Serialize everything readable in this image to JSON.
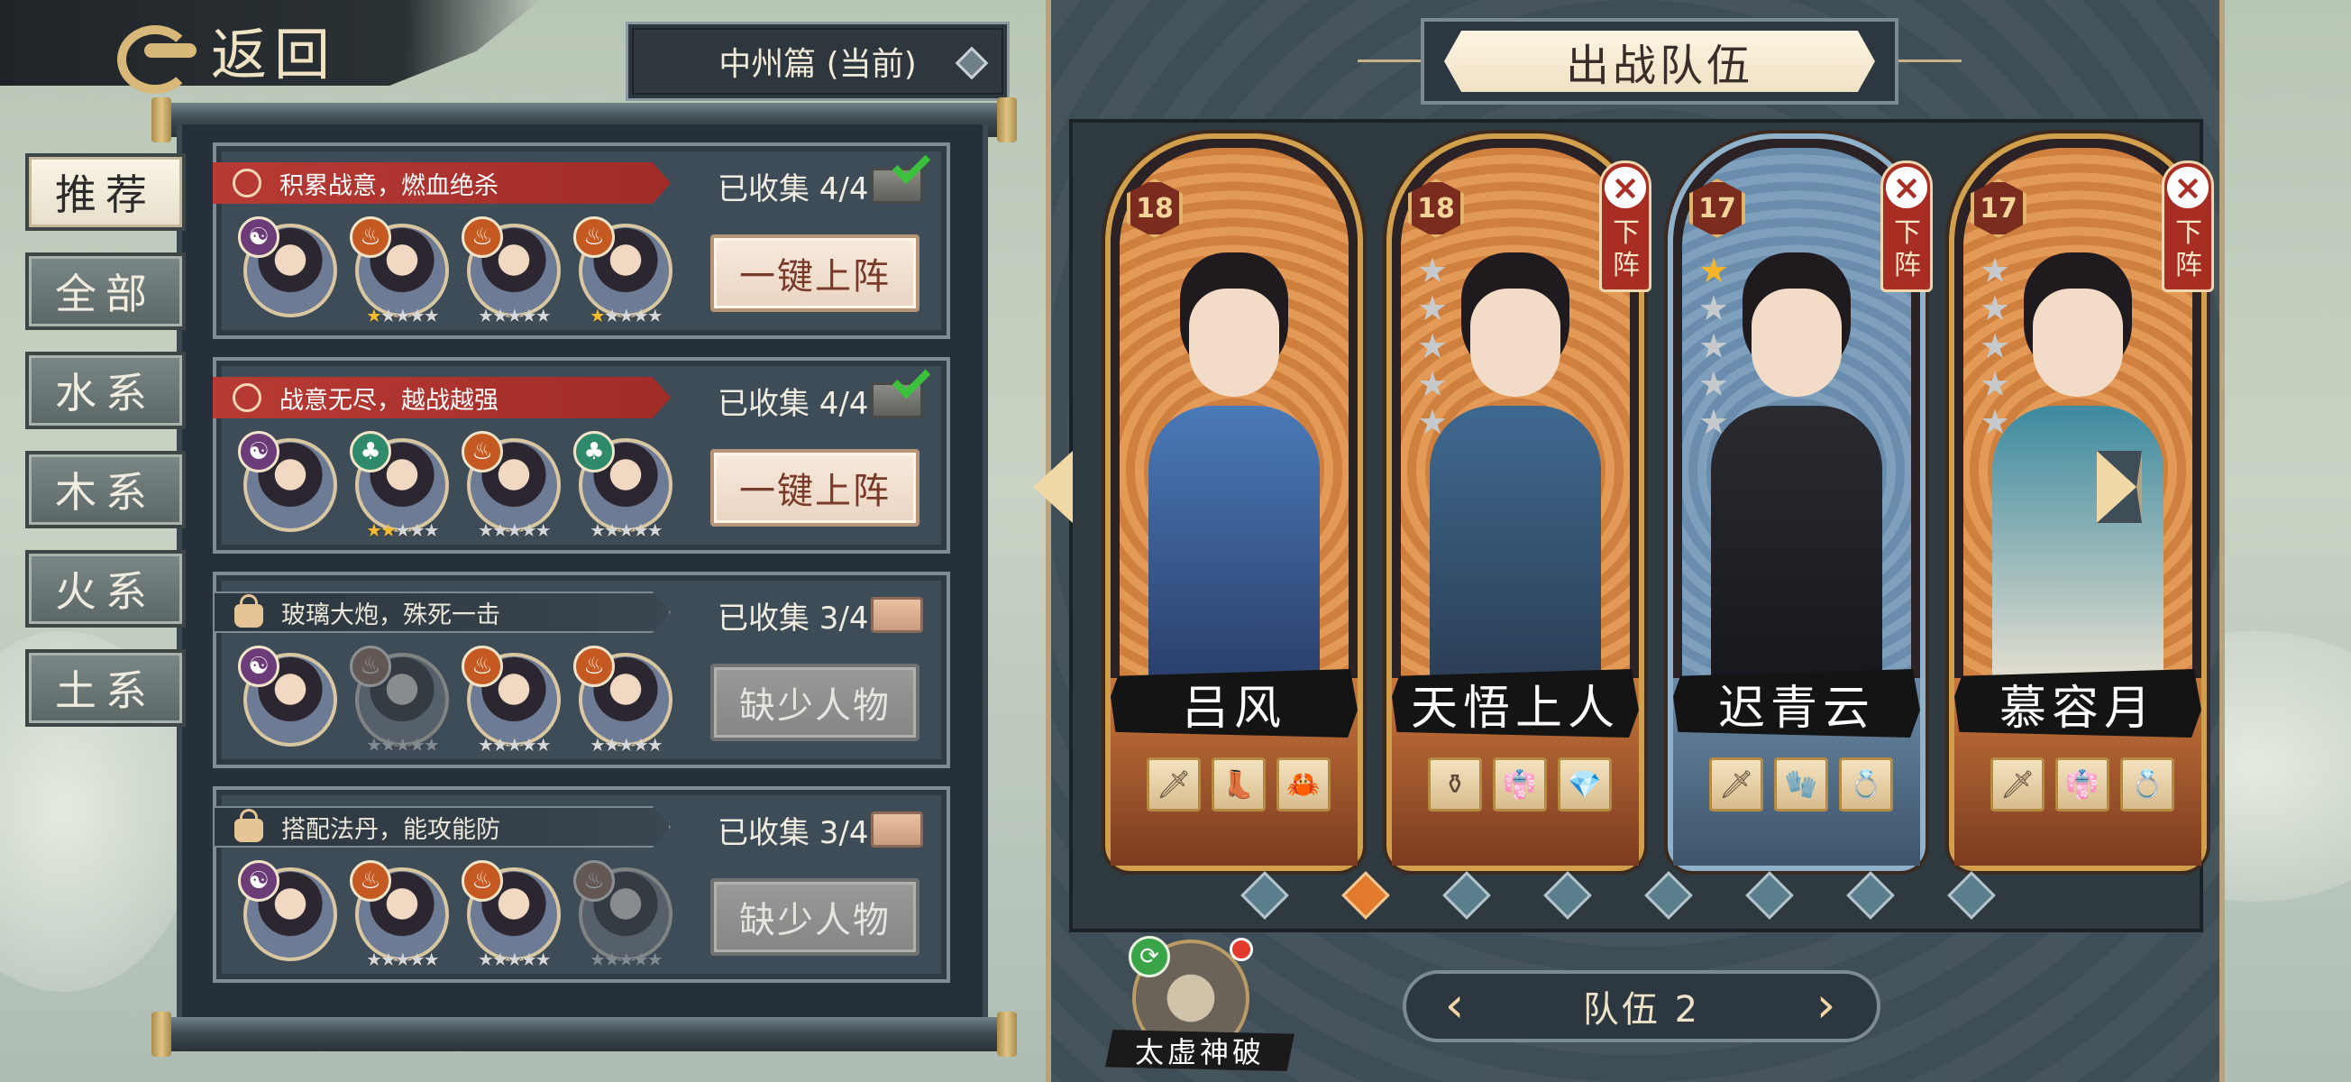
{
  "header": {
    "back_label": "返回"
  },
  "chapter_select": {
    "value": "中州篇 (当前)"
  },
  "tabs": [
    {
      "label": "推荐",
      "active": true
    },
    {
      "label": "全部"
    },
    {
      "label": "水系"
    },
    {
      "label": "木系"
    },
    {
      "label": "火系"
    },
    {
      "label": "土系"
    }
  ],
  "teams": [
    {
      "banner": "积累战意，燃血绝杀",
      "banner_style": "red",
      "collected": "已收集 4/4",
      "action": "一键上阵",
      "action_enabled": true,
      "members": [
        {
          "element": "yin",
          "stars": 0
        },
        {
          "element": "fire",
          "stars": 1
        },
        {
          "element": "fire",
          "stars": 0
        },
        {
          "element": "fire",
          "stars": 1
        }
      ]
    },
    {
      "banner": "战意无尽，越战越强",
      "banner_style": "red",
      "collected": "已收集 4/4",
      "action": "一键上阵",
      "action_enabled": true,
      "members": [
        {
          "element": "yin",
          "stars": 0
        },
        {
          "element": "wood",
          "stars": 2
        },
        {
          "element": "fire",
          "stars": 0
        },
        {
          "element": "wood",
          "stars": 0
        }
      ]
    },
    {
      "banner": "玻璃大炮，殊死一击",
      "banner_style": "dark",
      "collected": "已收集 3/4",
      "action": "缺少人物",
      "action_enabled": false,
      "members": [
        {
          "element": "yin",
          "stars": 0
        },
        {
          "element": "fire",
          "stars": 0,
          "missing": true
        },
        {
          "element": "fire",
          "stars": 0
        },
        {
          "element": "fire",
          "stars": 0
        }
      ]
    },
    {
      "banner": "搭配法丹，能攻能防",
      "banner_style": "dark",
      "collected": "已收集 3/4",
      "action": "缺少人物",
      "action_enabled": false,
      "members": [
        {
          "element": "yin",
          "stars": 0
        },
        {
          "element": "fire",
          "stars": 0
        },
        {
          "element": "fire",
          "stars": 0
        },
        {
          "element": "fire",
          "stars": 0,
          "missing": true
        }
      ]
    }
  ],
  "battle_team": {
    "title": "出战队伍",
    "remove_label": "下阵",
    "heroes": [
      {
        "name": "吕风",
        "level": "18",
        "stars": 0,
        "removable": false,
        "theme": "orange",
        "items": [
          "🗡",
          "👢",
          "🦀"
        ]
      },
      {
        "name": "天悟上人",
        "level": "18",
        "stars": 0,
        "removable": true,
        "theme": "orange",
        "items": [
          "⚱",
          "👘",
          "💎"
        ]
      },
      {
        "name": "迟青云",
        "level": "17",
        "stars": 1,
        "removable": true,
        "theme": "blue",
        "items": [
          "🗡",
          "🧤",
          "💍"
        ]
      },
      {
        "name": "慕容月",
        "level": "17",
        "stars": 0,
        "removable": true,
        "theme": "orange",
        "items": [
          "🗡",
          "👘",
          "💍"
        ]
      }
    ],
    "slot_count": 8,
    "active_slot": 1,
    "team_label": "队伍 2",
    "skill_name": "太虚神破"
  },
  "icons": {
    "back": "cloud-swirl-icon",
    "chapter": "diamond-icon",
    "zoom": "magnifier-icon",
    "lock": "lock-icon",
    "chest": "chest-icon",
    "check": "checkmark-icon"
  }
}
